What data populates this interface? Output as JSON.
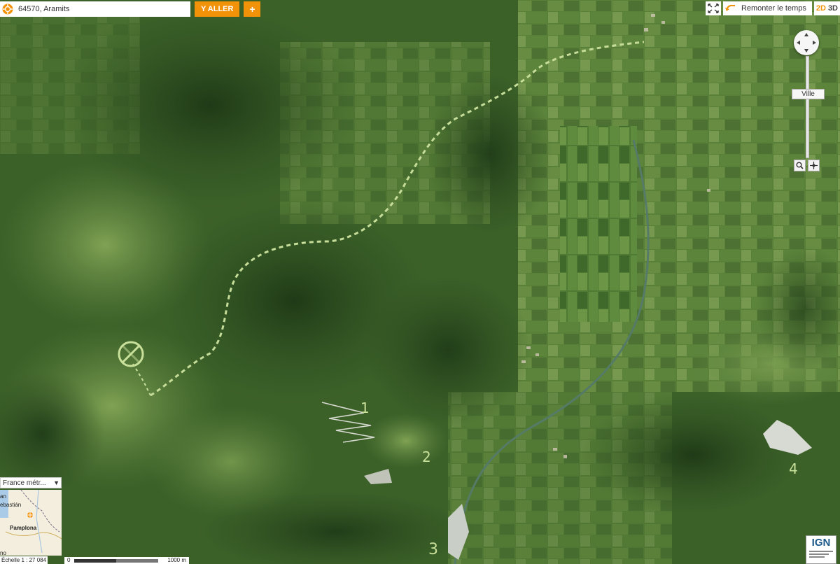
{
  "search": {
    "value": "64570, Aramits",
    "go_label": "Y ALLER",
    "add_label": "+"
  },
  "toolbar": {
    "time_label": "Remonter le temps",
    "mode_2d": "2D",
    "mode_3d": "3D"
  },
  "zoom": {
    "level_label": "Ville"
  },
  "minimap": {
    "selector": "France métr...",
    "places": [
      "an",
      "ebastián",
      "Pamplona",
      "no"
    ]
  },
  "scale": {
    "ratio": "Échelle 1 : 27 084",
    "zero": "0",
    "distance": "1000 m"
  },
  "map": {
    "annotations": [
      "1",
      "2",
      "3",
      "4"
    ]
  },
  "logo": {
    "text": "IGN"
  },
  "colors": {
    "accent": "#f29208",
    "route": "#c6dd9a"
  },
  "icons": {
    "location": "locate-icon",
    "fullscreen": "fullscreen-icon",
    "history": "history-arrow-icon",
    "pan": "pan-arrows-icon",
    "zoom": "magnifier-icon",
    "center": "crosshair-icon"
  }
}
